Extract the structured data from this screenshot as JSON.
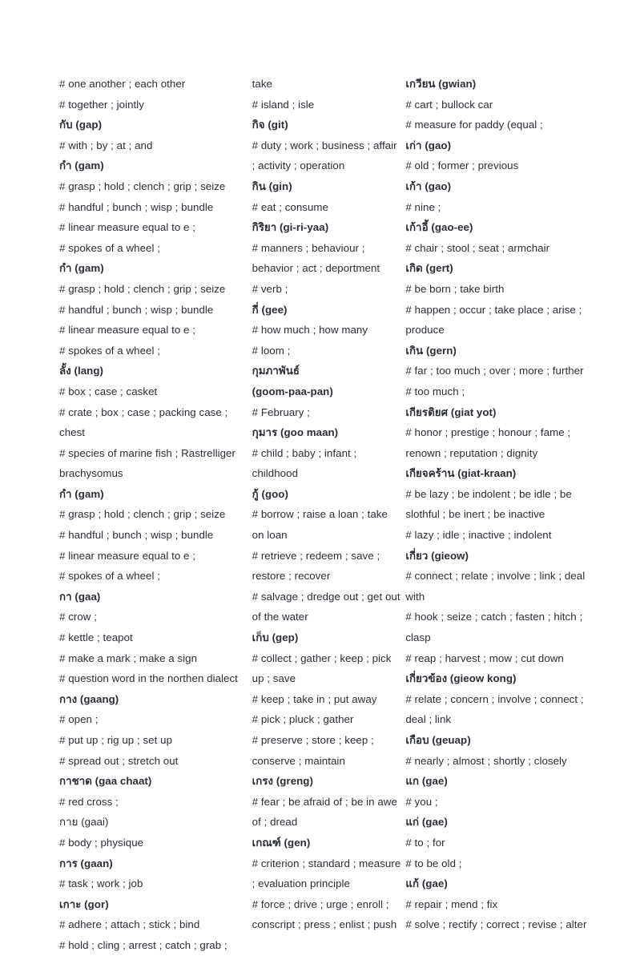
{
  "document": {
    "type": "thai-english-dictionary-page",
    "text_color": "#2b2e35",
    "background_color": "#ffffff"
  },
  "columns": [
    {
      "id": "column-1",
      "lines": [
        {
          "text": "# one another ; each other",
          "bold": false
        },
        {
          "text": "# together ; jointly",
          "bold": false
        },
        {
          "text": "กับ (gap)",
          "bold": true
        },
        {
          "text": "# with ; by ; at ; and",
          "bold": false
        },
        {
          "text": "กำ (gam)",
          "bold": true
        },
        {
          "text": "# grasp ; hold ; clench ; grip ; seize",
          "bold": false
        },
        {
          "text": "# handful ; bunch ; wisp ; bundle",
          "bold": false
        },
        {
          "text": "# linear measure equal to e ;",
          "bold": false
        },
        {
          "text": "# spokes of a wheel ;",
          "bold": false
        },
        {
          "text": "กำ (gam)",
          "bold": true
        },
        {
          "text": "# grasp ; hold ; clench ; grip ; seize",
          "bold": false
        },
        {
          "text": "# handful ; bunch ; wisp ; bundle",
          "bold": false
        },
        {
          "text": "# linear measure equal to e ;",
          "bold": false
        },
        {
          "text": "# spokes of a wheel ;",
          "bold": false
        },
        {
          "text": "ลั้ง (lang)",
          "bold": true
        },
        {
          "text": "# box ; case ; casket",
          "bold": false
        },
        {
          "text": "# crate ; box ; case ; packing case ; chest",
          "bold": false
        },
        {
          "text": "# species of marine fish ; Rastrelliger brachysomus",
          "bold": false
        },
        {
          "text": "กำ (gam)",
          "bold": true
        },
        {
          "text": "# grasp ; hold ; clench ; grip ; seize",
          "bold": false
        },
        {
          "text": "# handful ; bunch ; wisp ; bundle",
          "bold": false
        },
        {
          "text": "# linear measure equal to e ;",
          "bold": false
        },
        {
          "text": "# spokes of a wheel ;",
          "bold": false
        },
        {
          "text": "กา (gaa)",
          "bold": true
        },
        {
          "text": "# crow ;",
          "bold": false
        },
        {
          "text": "# kettle ; teapot",
          "bold": false
        },
        {
          "text": "# make a mark ; make a sign",
          "bold": false
        },
        {
          "text": "# question word in the northen dialect",
          "bold": false
        },
        {
          "text": "กาง (gaang)",
          "bold": true
        },
        {
          "text": "# open ;",
          "bold": false
        },
        {
          "text": "# put up ; rig up ; set up",
          "bold": false
        },
        {
          "text": "# spread out ; stretch out",
          "bold": false
        },
        {
          "text": "กาชาด (gaa chaat)",
          "bold": true
        },
        {
          "text": "# red cross ;",
          "bold": false
        },
        {
          "text": "กาย (gaai)",
          "bold": false
        },
        {
          "text": "# body ; physique",
          "bold": false
        },
        {
          "text": "การ (gaan)",
          "bold": true
        },
        {
          "text": "# task ; work ; job",
          "bold": false
        },
        {
          "text": "เกาะ (gor)",
          "bold": true
        },
        {
          "text": "# adhere ; attach ; stick ; bind",
          "bold": false
        },
        {
          "text": "# hold ; cling ; arrest ; catch ; grab ;",
          "bold": false
        }
      ]
    },
    {
      "id": "column-2",
      "lines": [
        {
          "text": "take",
          "bold": false
        },
        {
          "text": "# island ; isle",
          "bold": false
        },
        {
          "text": "กิจ (git)",
          "bold": true
        },
        {
          "text": "# duty ; work ; business ; affair ; activity ; operation",
          "bold": false
        },
        {
          "text": "กิน (gin)",
          "bold": true
        },
        {
          "text": "# eat ; consume",
          "bold": false
        },
        {
          "text": "กิริยา (gi-ri-yaa)",
          "bold": true
        },
        {
          "text": "# manners ; behaviour ; behavior ; act ; deportment",
          "bold": false
        },
        {
          "text": "# verb ;",
          "bold": false
        },
        {
          "text": "กี่ (gee)",
          "bold": true
        },
        {
          "text": "# how much ; how many",
          "bold": false
        },
        {
          "text": "# loom ;",
          "bold": false
        },
        {
          "text": "กุมภาพันธ์",
          "bold": true
        },
        {
          "text": "(goom-paa-pan)",
          "bold": true
        },
        {
          "text": "# February ;",
          "bold": false
        },
        {
          "text": "กุมาร (goo maan)",
          "bold": true
        },
        {
          "text": "# child ; baby ; infant ; childhood",
          "bold": false
        },
        {
          "text": "กู้ (goo)",
          "bold": true
        },
        {
          "text": "# borrow ; raise a loan ; take on loan",
          "bold": false
        },
        {
          "text": "# retrieve ; redeem ; save ; restore ; recover",
          "bold": false
        },
        {
          "text": "# salvage ; dredge out ; get out of the water",
          "bold": false
        },
        {
          "text": "เก็บ (gep)",
          "bold": true
        },
        {
          "text": "# collect ; gather ; keep ; pick up ; save",
          "bold": false
        },
        {
          "text": "# keep ; take in ; put away",
          "bold": false
        },
        {
          "text": "# pick ; pluck ; gather",
          "bold": false
        },
        {
          "text": "# preserve ; store ; keep ; conserve ; maintain",
          "bold": false
        },
        {
          "text": "เกรง (greng)",
          "bold": true
        },
        {
          "text": "# fear ; be afraid of ; be in awe of ; dread",
          "bold": false
        },
        {
          "text": "เกณฑ์ (gen)",
          "bold": true
        },
        {
          "text": "# criterion ; standard ; measure ; evaluation principle",
          "bold": false
        },
        {
          "text": "# force ; drive ; urge ; enroll ; conscript ; press ; enlist ; push",
          "bold": false
        }
      ]
    },
    {
      "id": "column-3",
      "lines": [
        {
          "text": "เกวียน (gwian)",
          "bold": true
        },
        {
          "text": "# cart ; bullock car",
          "bold": false
        },
        {
          "text": "# measure for paddy (equal ;",
          "bold": false
        },
        {
          "text": "เก่า (gao)",
          "bold": true
        },
        {
          "text": "# old ; former ; previous",
          "bold": false
        },
        {
          "text": "เก้า (gao)",
          "bold": true
        },
        {
          "text": "# nine ;",
          "bold": false
        },
        {
          "text": "เก้าอี้ (gao-ee)",
          "bold": true
        },
        {
          "text": "# chair ; stool ; seat ; armchair",
          "bold": false
        },
        {
          "text": "เกิด (gert)",
          "bold": true
        },
        {
          "text": "# be born ; take birth",
          "bold": false
        },
        {
          "text": "# happen ; occur ; take place ; arise ; produce",
          "bold": false
        },
        {
          "text": "เกิน (gern)",
          "bold": true
        },
        {
          "text": "# far ; too much ; over ; more ; further",
          "bold": false
        },
        {
          "text": "# too much ;",
          "bold": false
        },
        {
          "text": "เกียรติยศ (giat yot)",
          "bold": true
        },
        {
          "text": "# honor ; prestige ; honour ; fame ; renown ; reputation ; dignity",
          "bold": false
        },
        {
          "text": "เกียจคร้าน (giat-kraan)",
          "bold": true
        },
        {
          "text": "# be lazy ; be indolent ; be idle ; be slothful ; be inert ; be inactive",
          "bold": false
        },
        {
          "text": "# lazy ; idle ; inactive ; indolent",
          "bold": false
        },
        {
          "text": "เกี่ยว (gieow)",
          "bold": true
        },
        {
          "text": "# connect ; relate ; involve ; link ; deal with",
          "bold": false
        },
        {
          "text": "# hook ; seize ; catch ; fasten ; hitch ; clasp",
          "bold": false
        },
        {
          "text": "# reap ; harvest ; mow ; cut down",
          "bold": false
        },
        {
          "text": "เกี่ยวข้อง (gieow kong)",
          "bold": true
        },
        {
          "text": "# relate ; concern ; involve ; connect ; deal ; link",
          "bold": false
        },
        {
          "text": "เกือบ (geuap)",
          "bold": true
        },
        {
          "text": "# nearly ; almost ; shortly ; closely",
          "bold": false
        },
        {
          "text": "แก (gae)",
          "bold": true
        },
        {
          "text": "# you ;",
          "bold": false
        },
        {
          "text": "แก่ (gae)",
          "bold": true
        },
        {
          "text": "# to ; for",
          "bold": false
        },
        {
          "text": "# to be old ;",
          "bold": false
        },
        {
          "text": "แก้ (gae)",
          "bold": true
        },
        {
          "text": "# repair ; mend ; fix",
          "bold": false
        },
        {
          "text": "# solve ; rectify ; correct ; revise ; alter",
          "bold": false
        }
      ]
    }
  ]
}
